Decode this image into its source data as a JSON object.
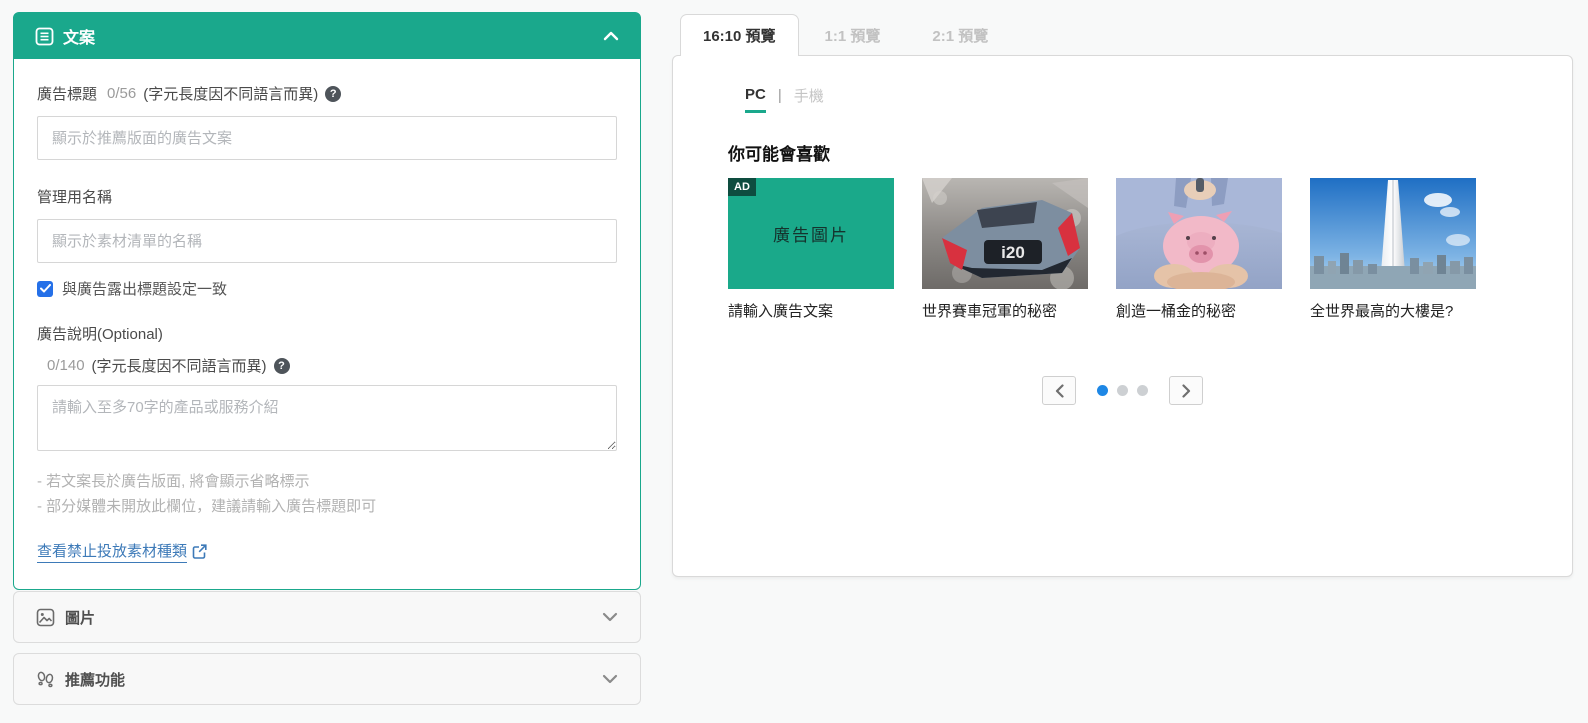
{
  "colors": {
    "accent_green": "#1aa88c",
    "checkbox_blue": "#2570e8",
    "active_dot_blue": "#1e87e5",
    "link_blue": "#3d7ab8"
  },
  "icons": {
    "help": "?"
  },
  "copy_panel": {
    "title": "文案",
    "ad_title": {
      "label": "廣告標題",
      "counter": "0/56",
      "hint": "(字元長度因不同語言而異)",
      "placeholder": "顯示於推薦版面的廣告文案"
    },
    "admin_name": {
      "label": "管理用名稱",
      "placeholder": "顯示於素材清單的名稱"
    },
    "checkbox_label": "與廣告露出標題設定一致",
    "ad_desc": {
      "label": "廣告說明(Optional)",
      "counter": "0/140",
      "hint": "(字元長度因不同語言而異)",
      "placeholder": "請輸入至多70字的產品或服務介紹"
    },
    "notes": [
      "- 若文案長於廣告版面, 將會顯示省略標示",
      "- 部分媒體未開放此欄位，建議請輸入廣告標題即可"
    ],
    "link_label": "查看禁止投放素材種類"
  },
  "sections": [
    {
      "label": "圖片"
    },
    {
      "label": "推薦功能"
    }
  ],
  "preview": {
    "tabs": [
      {
        "label": "16:10 預覽",
        "active": true
      },
      {
        "label": "1:1 預覽",
        "active": false
      },
      {
        "label": "2:1 預覽",
        "active": false
      }
    ],
    "device_toggle": {
      "pc": "PC",
      "separator": "|",
      "mobile": "手機"
    },
    "heading": "你可能會喜歡",
    "cards": [
      {
        "badge": "AD",
        "image_label": "廣告圖片",
        "caption": "請輸入廣告文案"
      },
      {
        "image_text": "i20",
        "caption": "世界賽車冠軍的秘密"
      },
      {
        "caption": "創造一桶金的秘密"
      },
      {
        "caption": "全世界最高的大樓是?"
      }
    ],
    "carousel": {
      "dots": 3,
      "active_dot": 0
    }
  }
}
